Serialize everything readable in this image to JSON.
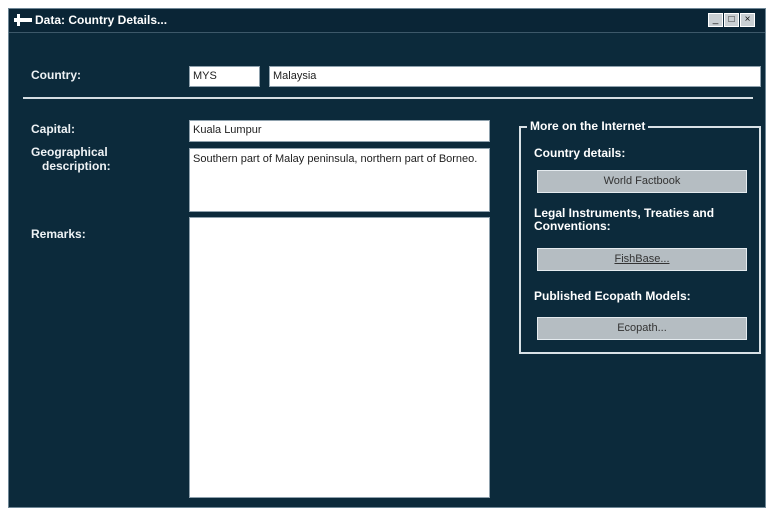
{
  "window": {
    "title": "Data: Country Details...",
    "controls": {
      "minimize": "_",
      "maximize": "□",
      "close": "×"
    }
  },
  "country": {
    "label": "Country:",
    "code": "MYS",
    "name": "Malaysia"
  },
  "capital": {
    "label": "Capital:",
    "value": "Kuala Lumpur"
  },
  "geo": {
    "label_line1": "Geographical",
    "label_line2": "description:",
    "value": "Southern part of Malay peninsula, northern part of Borneo."
  },
  "remarks": {
    "label": "Remarks:",
    "value": ""
  },
  "internet": {
    "title": "More on the Internet",
    "country_details_label": "Country details:",
    "factbook_button": "World Factbook",
    "legal_label": "Legal Instruments, Treaties and Conventions:",
    "fishbase_button": "FishBase...",
    "ecopath_label": "Published Ecopath Models:",
    "ecopath_button": "Ecopath..."
  }
}
